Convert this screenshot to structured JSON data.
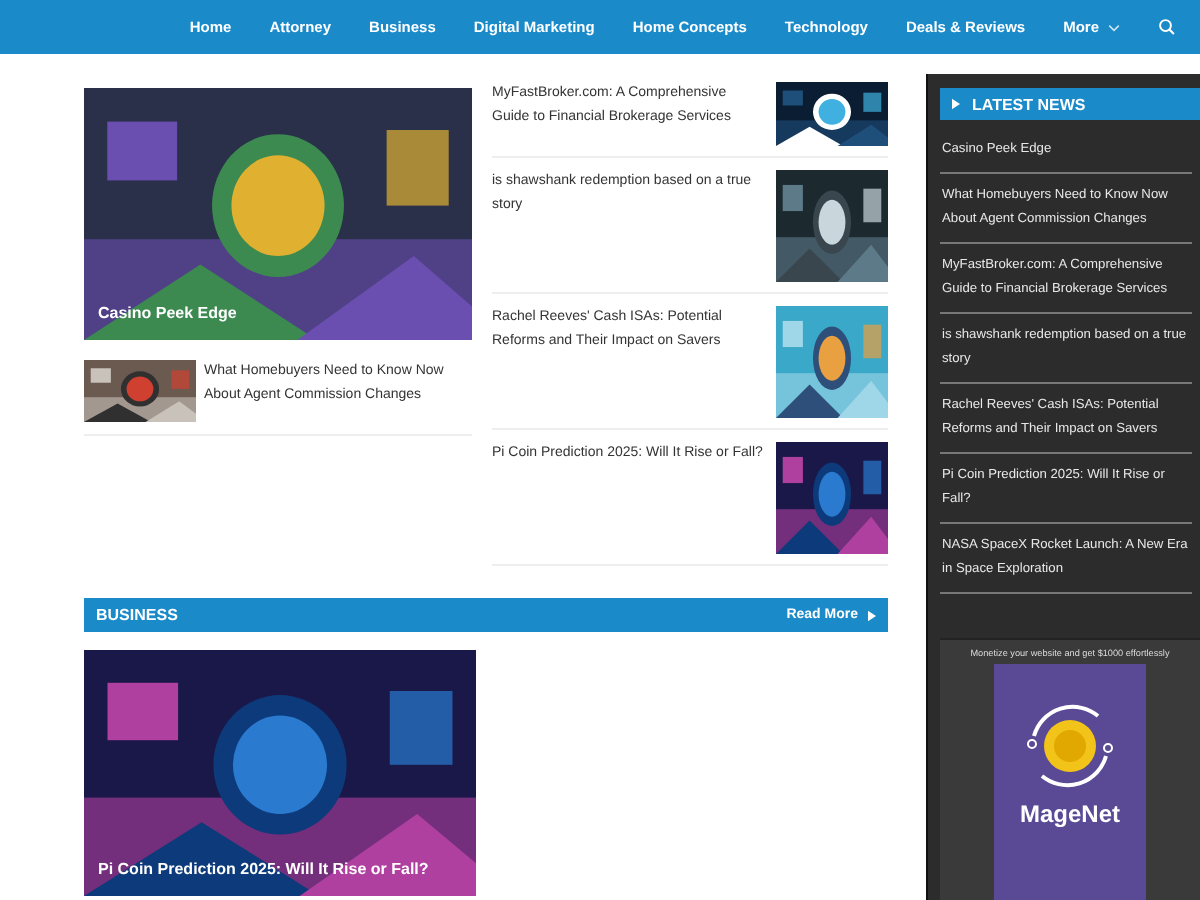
{
  "nav": {
    "items": [
      {
        "label": "Home"
      },
      {
        "label": "Attorney"
      },
      {
        "label": "Business"
      },
      {
        "label": "Digital Marketing"
      },
      {
        "label": "Home Concepts"
      },
      {
        "label": "Technology"
      },
      {
        "label": "Deals & Reviews"
      },
      {
        "label": "More",
        "dropdown": true
      }
    ]
  },
  "featured": {
    "title": "Casino Peek Edge"
  },
  "small_post": {
    "title": "What Homebuyers Need to Know Now About Agent Commission Changes"
  },
  "list_posts": [
    {
      "title": "MyFastBroker.com: A Comprehensive Guide to Financial Brokerage Services"
    },
    {
      "title": "is shawshank redemption based on a true story"
    },
    {
      "title": "Rachel Reeves' Cash ISAs: Potential Reforms and Their Impact on Savers"
    },
    {
      "title": "Pi Coin Prediction 2025: Will It Rise or Fall?"
    }
  ],
  "business": {
    "heading": "BUSINESS",
    "read_more": "Read More",
    "post": {
      "title": "Pi Coin Prediction 2025: Will It Rise or Fall?"
    }
  },
  "sidebar": {
    "heading": "LATEST NEWS",
    "items": [
      "Casino Peek Edge",
      "What Homebuyers Need to Know Now About Agent Commission Changes",
      "MyFastBroker.com: A Comprehensive Guide to Financial Brokerage Services",
      "is shawshank redemption based on a true story",
      "Rachel Reeves' Cash ISAs: Potential Reforms and Their Impact on Savers",
      "Pi Coin Prediction 2025: Will It Rise or Fall?",
      "NASA SpaceX Rocket Launch: A New Era in Space Exploration"
    ],
    "ad": {
      "caption": "Monetize your website and get $1000 effortlessly",
      "logo": "MageNet"
    }
  }
}
